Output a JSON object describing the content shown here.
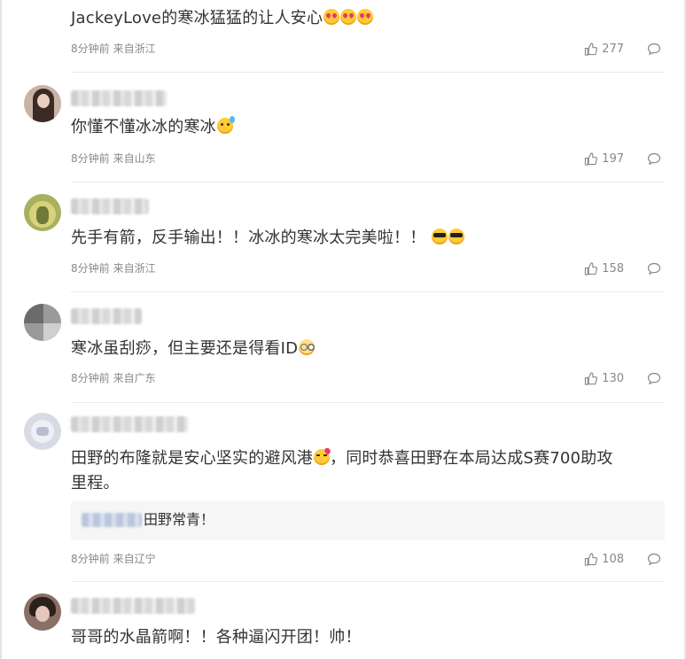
{
  "comments": [
    {
      "text": "JackeyLove的寒冰猛猛的让人安心",
      "emojis": [
        "heart-eyes-emoji",
        "heart-eyes-emoji",
        "heart-eyes-emoji"
      ],
      "time": "8分钟前",
      "location": "来自浙江",
      "likes": "277"
    },
    {
      "text": "你懂不懂冰冰的寒冰",
      "emojis": [
        "sweat-emoji"
      ],
      "time": "8分钟前",
      "location": "来自山东",
      "likes": "197"
    },
    {
      "text": "先手有箭，反手输出！！冰冰的寒冰太完美啦！！",
      "emojis": [
        "cool-emoji",
        "cool-emoji"
      ],
      "time": "8分钟前",
      "location": "来自浙江",
      "likes": "158"
    },
    {
      "text": "寒冰虽刮痧，但主要还是得看ID",
      "emojis": [
        "glasses-emoji"
      ],
      "time": "8分钟前",
      "location": "来自广东",
      "likes": "130"
    },
    {
      "text_a": "田野的布隆就是安心坚实的避风港",
      "text_b": "，同时恭喜田野在本局达成S赛700助攻",
      "text_c": "里程。",
      "emojis": [
        "kiss-emoji"
      ],
      "reply": {
        "text": "田野常青！"
      },
      "time": "8分钟前",
      "location": "来自辽宁",
      "likes": "108"
    },
    {
      "text": "哥哥的水晶箭啊！！各种逼闪开团！帅！"
    }
  ],
  "icons": {
    "like": "thumbs-up-icon",
    "reply": "comment-bubble-icon"
  },
  "colors": {
    "text": "#333333",
    "meta": "#888888",
    "divider": "#eaeaea",
    "reply_bg": "#f6f6f6"
  }
}
